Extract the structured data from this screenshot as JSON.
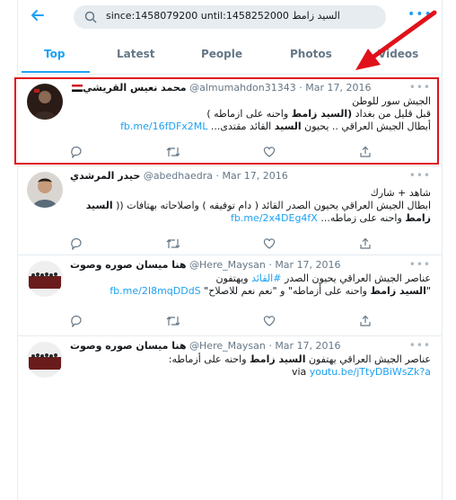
{
  "search": {
    "query": "since:1458079200 until:1458252000 السيد زامط"
  },
  "tabs": [
    {
      "label": "Top"
    },
    {
      "label": "Latest"
    },
    {
      "label": "People"
    },
    {
      "label": "Photos"
    },
    {
      "label": "Videos"
    }
  ],
  "tweets": [
    {
      "name": "محمد نعيس القريشي",
      "handle": "@almumahdon31343",
      "dot": "·",
      "date": "Mar 17, 2016",
      "line1": "الجيش سور للوطن",
      "line2_pre": "قبل قليل من بغداد ",
      "line2_bold": "(السيد زامط",
      "line2_post": " واحنه على ازماطه )",
      "line3_pre": "أبطال الجيش العراقي .. يحيون ",
      "line3_bold": "السيد",
      "line3_post": " القائد مقتدى... ",
      "link": "fb.me/16fDFx2ML"
    },
    {
      "name": "حيدر المرشدي",
      "handle": "@abedhaedra",
      "dot": "·",
      "date": "Mar 17, 2016",
      "line1": "شاهد + شارك",
      "line2_pre": "ابطال الجيش العراقي يحيون الصدر القائد ( دام توفيقه ) واصلاحاته بهتافات (( ",
      "line2_bold": "السيد",
      "line3_bold": "زامط",
      "line3_post": " واحنه على زماطه... ",
      "link": "fb.me/2x4DEg4fX"
    },
    {
      "name": "هنا ميسان صوره وصوت",
      "handle": "@Here_Maysan",
      "dot": "·",
      "date": "Mar 17, 2016",
      "line1_pre": "عناصر الجيش العراقي يحيون الصدر ",
      "line1_tag": "#القائد",
      "line1_post": " ويهتفون",
      "line2_pre": "\"",
      "line2_bold": "السيد زامط",
      "line2_post": " واحنه على أزماطه\" و \"نعم نعم للاصلاح\" ",
      "link": "fb.me/2I8mqDDdS"
    },
    {
      "name": "هنا ميسان صوره وصوت",
      "handle": "@Here_Maysan",
      "dot": "·",
      "date": "Mar 17, 2016",
      "line1_pre": "عناصر الجيش العراقي يهتفون ",
      "line1_bold": "السيد زامط",
      "line1_post": " واحنه على أزماطه:",
      "via": "via ",
      "link": "youtu.be/jTtyDBiWsZk?a"
    }
  ],
  "colors": {
    "accent": "#1da1f2",
    "highlight": "#e0111b"
  }
}
